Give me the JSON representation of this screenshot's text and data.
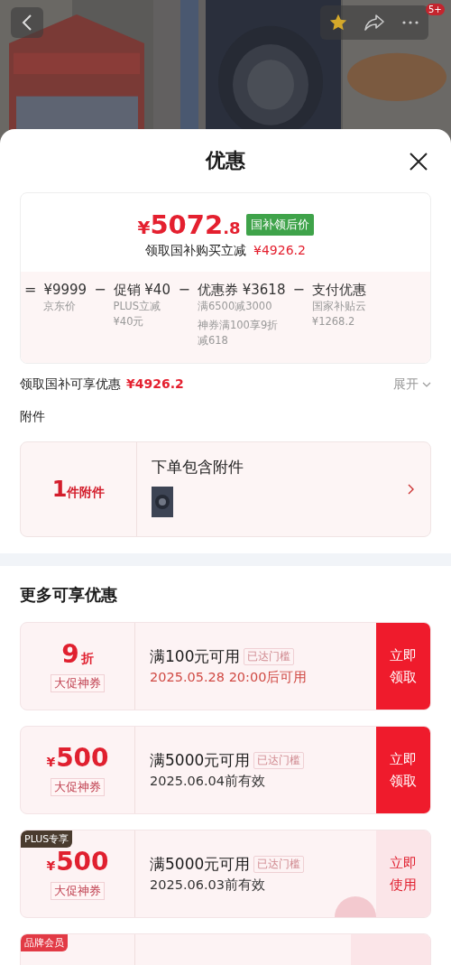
{
  "header": {
    "badge": "5+"
  },
  "sheet": {
    "title": "优惠"
  },
  "price_card": {
    "currency": "¥",
    "price_main": "5072",
    "price_decimal": ".8",
    "price_tag": "国补领后价",
    "subtitle": "领取国补购买立减",
    "subtitle_amount": "¥4926.2",
    "breakdown": [
      {
        "op": "=",
        "title": "¥9999",
        "notes": [
          "京东价"
        ]
      },
      {
        "op": "−",
        "title": "促销 ¥40",
        "notes": [
          "PLUS立减¥40元"
        ]
      },
      {
        "op": "−",
        "title": "优惠券 ¥3618",
        "notes": [
          "满6500减3000",
          "神券满100享9折减618"
        ]
      },
      {
        "op": "−",
        "title": "支付优惠",
        "notes": [
          "国家补贴云",
          "¥1268.2"
        ]
      }
    ]
  },
  "subsidy": {
    "label": "领取国补可享优惠",
    "amount": "¥4926.2",
    "toggle": "展开"
  },
  "attachments": {
    "heading": "附件",
    "count": "1",
    "count_label": "件附件",
    "title": "下单包含附件"
  },
  "more": {
    "heading": "更多可享优惠",
    "coupons": [
      {
        "kind": "discount",
        "value": "9",
        "unit": "折",
        "type_label": "大促神券",
        "condition": "满100元可用",
        "status": "已达门槛",
        "date": "2025.05.28 20:00后可用",
        "date_pending": true,
        "action": "立即领取",
        "action_highlighted": true
      },
      {
        "kind": "amount",
        "value": "500",
        "unit": "¥",
        "type_label": "大促神券",
        "condition": "满5000元可用",
        "status": "已达门槛",
        "date": "2025.06.04前有效",
        "date_pending": false,
        "action": "立即领取",
        "action_highlighted": true
      },
      {
        "kind": "amount",
        "tag": "PLUS专享",
        "color": "#4a3b2e",
        "value": "500",
        "unit": "¥",
        "type_label": "大促神券",
        "condition": "满5000元可用",
        "status": "已达门槛",
        "date": "2025.06.03前有效",
        "date_pending": false,
        "action": "立即使用",
        "action_highlighted": false,
        "stamp": true
      },
      {
        "kind": "partial",
        "tag": "品牌会员",
        "color": "#e23a45"
      }
    ]
  }
}
